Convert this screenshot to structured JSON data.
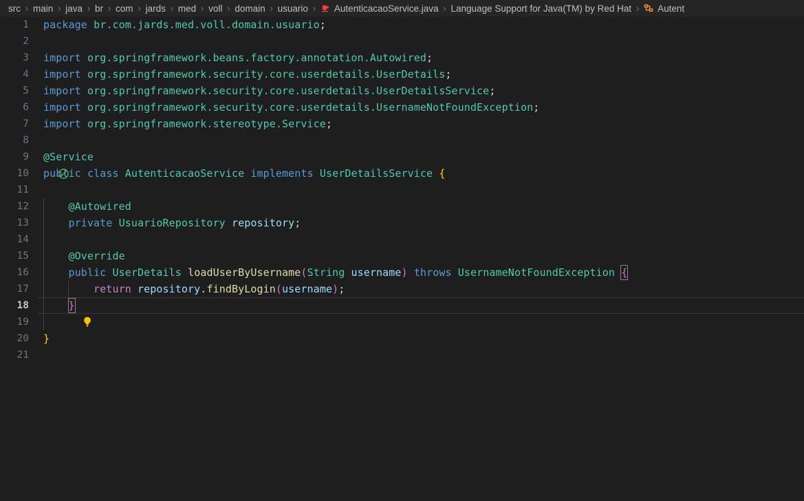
{
  "breadcrumb": {
    "items": [
      {
        "label": "src",
        "icon": null
      },
      {
        "label": "main",
        "icon": null
      },
      {
        "label": "java",
        "icon": null
      },
      {
        "label": "br",
        "icon": null
      },
      {
        "label": "com",
        "icon": null
      },
      {
        "label": "jards",
        "icon": null
      },
      {
        "label": "med",
        "icon": null
      },
      {
        "label": "voll",
        "icon": null
      },
      {
        "label": "domain",
        "icon": null
      },
      {
        "label": "usuario",
        "icon": null
      },
      {
        "label": "AutenticacaoService.java",
        "icon": "java-file-icon"
      },
      {
        "label": "Language Support for Java(TM) by Red Hat",
        "icon": null
      },
      {
        "label": "Autent",
        "icon": "class-symbol-icon"
      }
    ],
    "separator": "›"
  },
  "editor": {
    "active_line": 18,
    "language": "java",
    "first_line": 1,
    "last_line": 21,
    "lines": [
      {
        "n": 1,
        "text": "package br.com.jards.med.voll.domain.usuario;"
      },
      {
        "n": 2,
        "text": ""
      },
      {
        "n": 3,
        "text": "import org.springframework.beans.factory.annotation.Autowired;"
      },
      {
        "n": 4,
        "text": "import org.springframework.security.core.userdetails.UserDetails;"
      },
      {
        "n": 5,
        "text": "import org.springframework.security.core.userdetails.UserDetailsService;"
      },
      {
        "n": 6,
        "text": "import org.springframework.security.core.userdetails.UsernameNotFoundException;"
      },
      {
        "n": 7,
        "text": "import org.springframework.stereotype.Service;"
      },
      {
        "n": 8,
        "text": ""
      },
      {
        "n": 9,
        "text": "@Service"
      },
      {
        "n": 10,
        "text": "public class AutenticacaoService implements UserDetailsService {"
      },
      {
        "n": 11,
        "text": ""
      },
      {
        "n": 12,
        "text": "    @Autowired"
      },
      {
        "n": 13,
        "text": "    private UsuarioRepository repository;"
      },
      {
        "n": 14,
        "text": ""
      },
      {
        "n": 15,
        "text": "    @Override"
      },
      {
        "n": 16,
        "text": "    public UserDetails loadUserByUsername(String username) throws UsernameNotFoundException {"
      },
      {
        "n": 17,
        "text": "        return repository.findByLogin(username);"
      },
      {
        "n": 18,
        "text": "    }"
      },
      {
        "n": 19,
        "text": ""
      },
      {
        "n": 20,
        "text": "}"
      },
      {
        "n": 21,
        "text": ""
      }
    ],
    "tokens": {
      "line1": {
        "kw": "package",
        "pkg": "br.com.jards.med.voll.domain.usuario",
        "end": ";"
      },
      "line3": {
        "kw": "import",
        "pkg": "org.springframework.beans.factory.annotation.",
        "type": "Autowired",
        "end": ";"
      },
      "line4": {
        "kw": "import",
        "pkg": "org.springframework.security.core.userdetails.",
        "type": "UserDetails",
        "end": ";"
      },
      "line5": {
        "kw": "import",
        "pkg": "org.springframework.security.core.userdetails.",
        "type": "UserDetailsService",
        "end": ";"
      },
      "line6": {
        "kw": "import",
        "pkg": "org.springframework.security.core.userdetails.",
        "type": "UsernameNotFoundException",
        "end": ";"
      },
      "line7": {
        "kw": "import",
        "pkg": "org.springframework.stereotype.",
        "type": "Service",
        "end": ";"
      },
      "line9": {
        "annotation": "@Service"
      },
      "line10": {
        "kw1": "public",
        "kw2": "class",
        "name": "AutenticacaoService",
        "kw3": "implements",
        "iface": "UserDetailsService",
        "brace": "{"
      },
      "line12": {
        "annotation": "@Autowired"
      },
      "line13": {
        "kw": "private",
        "type": "UsuarioRepository",
        "var": "repository",
        "end": ";"
      },
      "line15": {
        "annotation": "@Override"
      },
      "line16": {
        "kw1": "public",
        "ret": "UserDetails",
        "method": "loadUserByUsername",
        "paren_open": "(",
        "ptype": "String",
        "pname": "username",
        "paren_close": ")",
        "kw2": "throws",
        "exc": "UsernameNotFoundException",
        "brace": "{"
      },
      "line17": {
        "kw": "return",
        "var": "repository",
        "dot": ".",
        "method": "findByLogin",
        "paren_open": "(",
        "arg": "username",
        "paren_close": ")",
        "end": ";"
      },
      "line18": {
        "brace": "}"
      },
      "line20": {
        "brace": "}"
      }
    },
    "gutter": {
      "line9_icon": "spring-bean-icon",
      "line18_icon": "lightbulb-quickfix-icon"
    }
  },
  "colors": {
    "background": "#1e1e1e",
    "breadcrumb_background": "#252526",
    "keyword": "#569cd6",
    "control_keyword": "#c586c0",
    "type": "#4ec9b0",
    "method": "#dcdcaa",
    "variable": "#9cdcfe",
    "bracket_level1": "#ffd700",
    "bracket_level2": "#da70d6",
    "bracket_level3": "#179fff",
    "line_number": "#6e7681",
    "active_line_number": "#c6c6c6",
    "java_icon": "#e8453c",
    "bean_icon": "#56a64b",
    "bulb_icon": "#fcc200",
    "class_symbol_icon": "#ee9d28"
  }
}
